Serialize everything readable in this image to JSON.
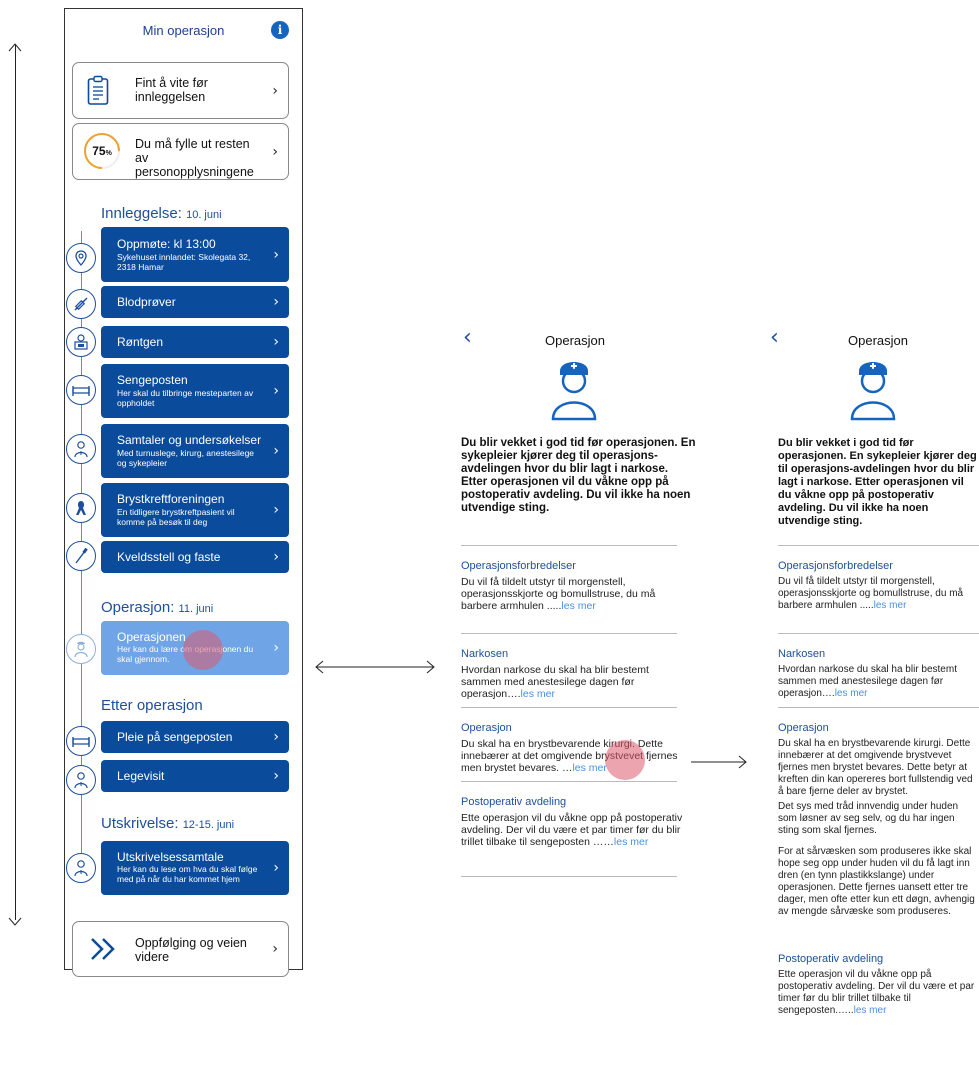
{
  "colors": {
    "brand": "#0b4b9c",
    "accent": "#1565c0",
    "link": "#4a90e2",
    "progress": "#f0a030"
  },
  "phone1": {
    "title": "Min operasjon",
    "info_icon": "i",
    "card_before": "Fint å vite før innleggelsen",
    "progress_value": "75",
    "progress_unit": "%",
    "progress_fraction": 0.75,
    "card_progress": "Du må fylle ut resten av personopplysningene",
    "section1_title": "Innleggelse:",
    "section1_date": "10. juni",
    "items1": [
      {
        "title": "Oppmøte: kl 13:00",
        "sub": "Sykehuset innlandet: Skolegata 32, 2318 Hamar",
        "icon": "location-pin-icon"
      },
      {
        "title": "Blodprøver",
        "sub": "",
        "icon": "syringe-icon"
      },
      {
        "title": "Røntgen",
        "sub": "",
        "icon": "xray-person-icon"
      },
      {
        "title": "Sengeposten",
        "sub": "Her skal du tilbringe mesteparten av oppholdet",
        "icon": "bed-icon"
      },
      {
        "title": "Samtaler og undersøkelser",
        "sub": "Med turnuslege, kirurg, anestesilege og sykepleier",
        "icon": "doctor-icon"
      },
      {
        "title": "Brystkreftforeningen",
        "sub": "En tidligere brystkreftpasient vil komme på besøk til deg",
        "icon": "ribbon-icon"
      },
      {
        "title": "Kveldsstell og faste",
        "sub": "",
        "icon": "toothbrush-icon"
      }
    ],
    "section2_title": "Operasjon:",
    "section2_date": "11. juni",
    "item_operation": {
      "title": "Operasjonen",
      "sub": "Her kan du lære om operasjonen du skal gjennom.",
      "icon": "surgeon-icon"
    },
    "section3_title": "Etter operasjon",
    "items3": [
      {
        "title": "Pleie på sengeposten",
        "icon": "bed-icon"
      },
      {
        "title": "Legevisit",
        "icon": "doctor-icon"
      }
    ],
    "section4_title": "Utskrivelse:",
    "section4_date": "12-15. juni",
    "item_discharge": {
      "title": "Utskrivelsessamtale",
      "sub": "Her kan du lese om hva du skal følge med på når du har kommet hjem",
      "icon": "doctor-icon"
    },
    "card_followup": "Oppfølging og veien videre"
  },
  "screen": {
    "title": "Operasjon",
    "intro": "Du blir vekket i god tid før operasjonen. En sykepleier kjører deg til operasjons-avdelingen hvor du blir lagt i narkose. Etter operasjonen vil du våkne opp på postoperativ avdeling. Du vil ikke ha noen utvendige sting.",
    "sec1_title": "Operasjonsforbredelser",
    "sec1_text": "Du vil få tildelt utstyr til morgenstell, operasjonsskjorte og bomullstruse, du må barbere armhulen .....",
    "sec2_title": "Narkosen",
    "sec2_text": "Hvordan narkose du skal ha blir bestemt sammen med anestesilege dagen før operasjon….",
    "sec3_title": "Operasjon",
    "sec3_text_short": "Du skal ha en brystbevarende kirurgi. Dette innebærer at det omgivende brystvevet fjernes men brystet bevares. …",
    "sec3_text_long_1": "Du skal ha en brystbevarende kirurgi. Dette innebærer at det omgivende brystvevet fjernes men brystet bevares. Dette betyr at kreften din kan opereres bort fullstendig ved å bare fjerne deler av brystet.",
    "sec3_text_long_2": "Det sys med tråd innvendig under huden som løsner av seg selv, og du har ingen sting som skal fjernes.",
    "sec3_text_long_3": "For at sårvæsken som produseres ikke skal hope seg opp under huden vil du få lagt inn dren (en tynn plastikkslange) under operasjonen. Dette fjernes uansett etter tre dager, men ofte etter kun ett døgn, avhengig av mengde sårvæske som produseres.",
    "sec4_title": "Postoperativ avdeling",
    "sec4_text": "Ette operasjon vil du våkne opp på postoperativ avdeling. Der vil du være et par timer før du blir trillet tilbake til sengeposten ……",
    "sec4_text_b": "Ette operasjon vil du våkne opp på postoperativ avdeling. Der vil du være et par timer før du blir trillet tilbake til sengeposten.…..",
    "read_more": "les mer",
    "back_icon": "chevron-left-icon"
  }
}
